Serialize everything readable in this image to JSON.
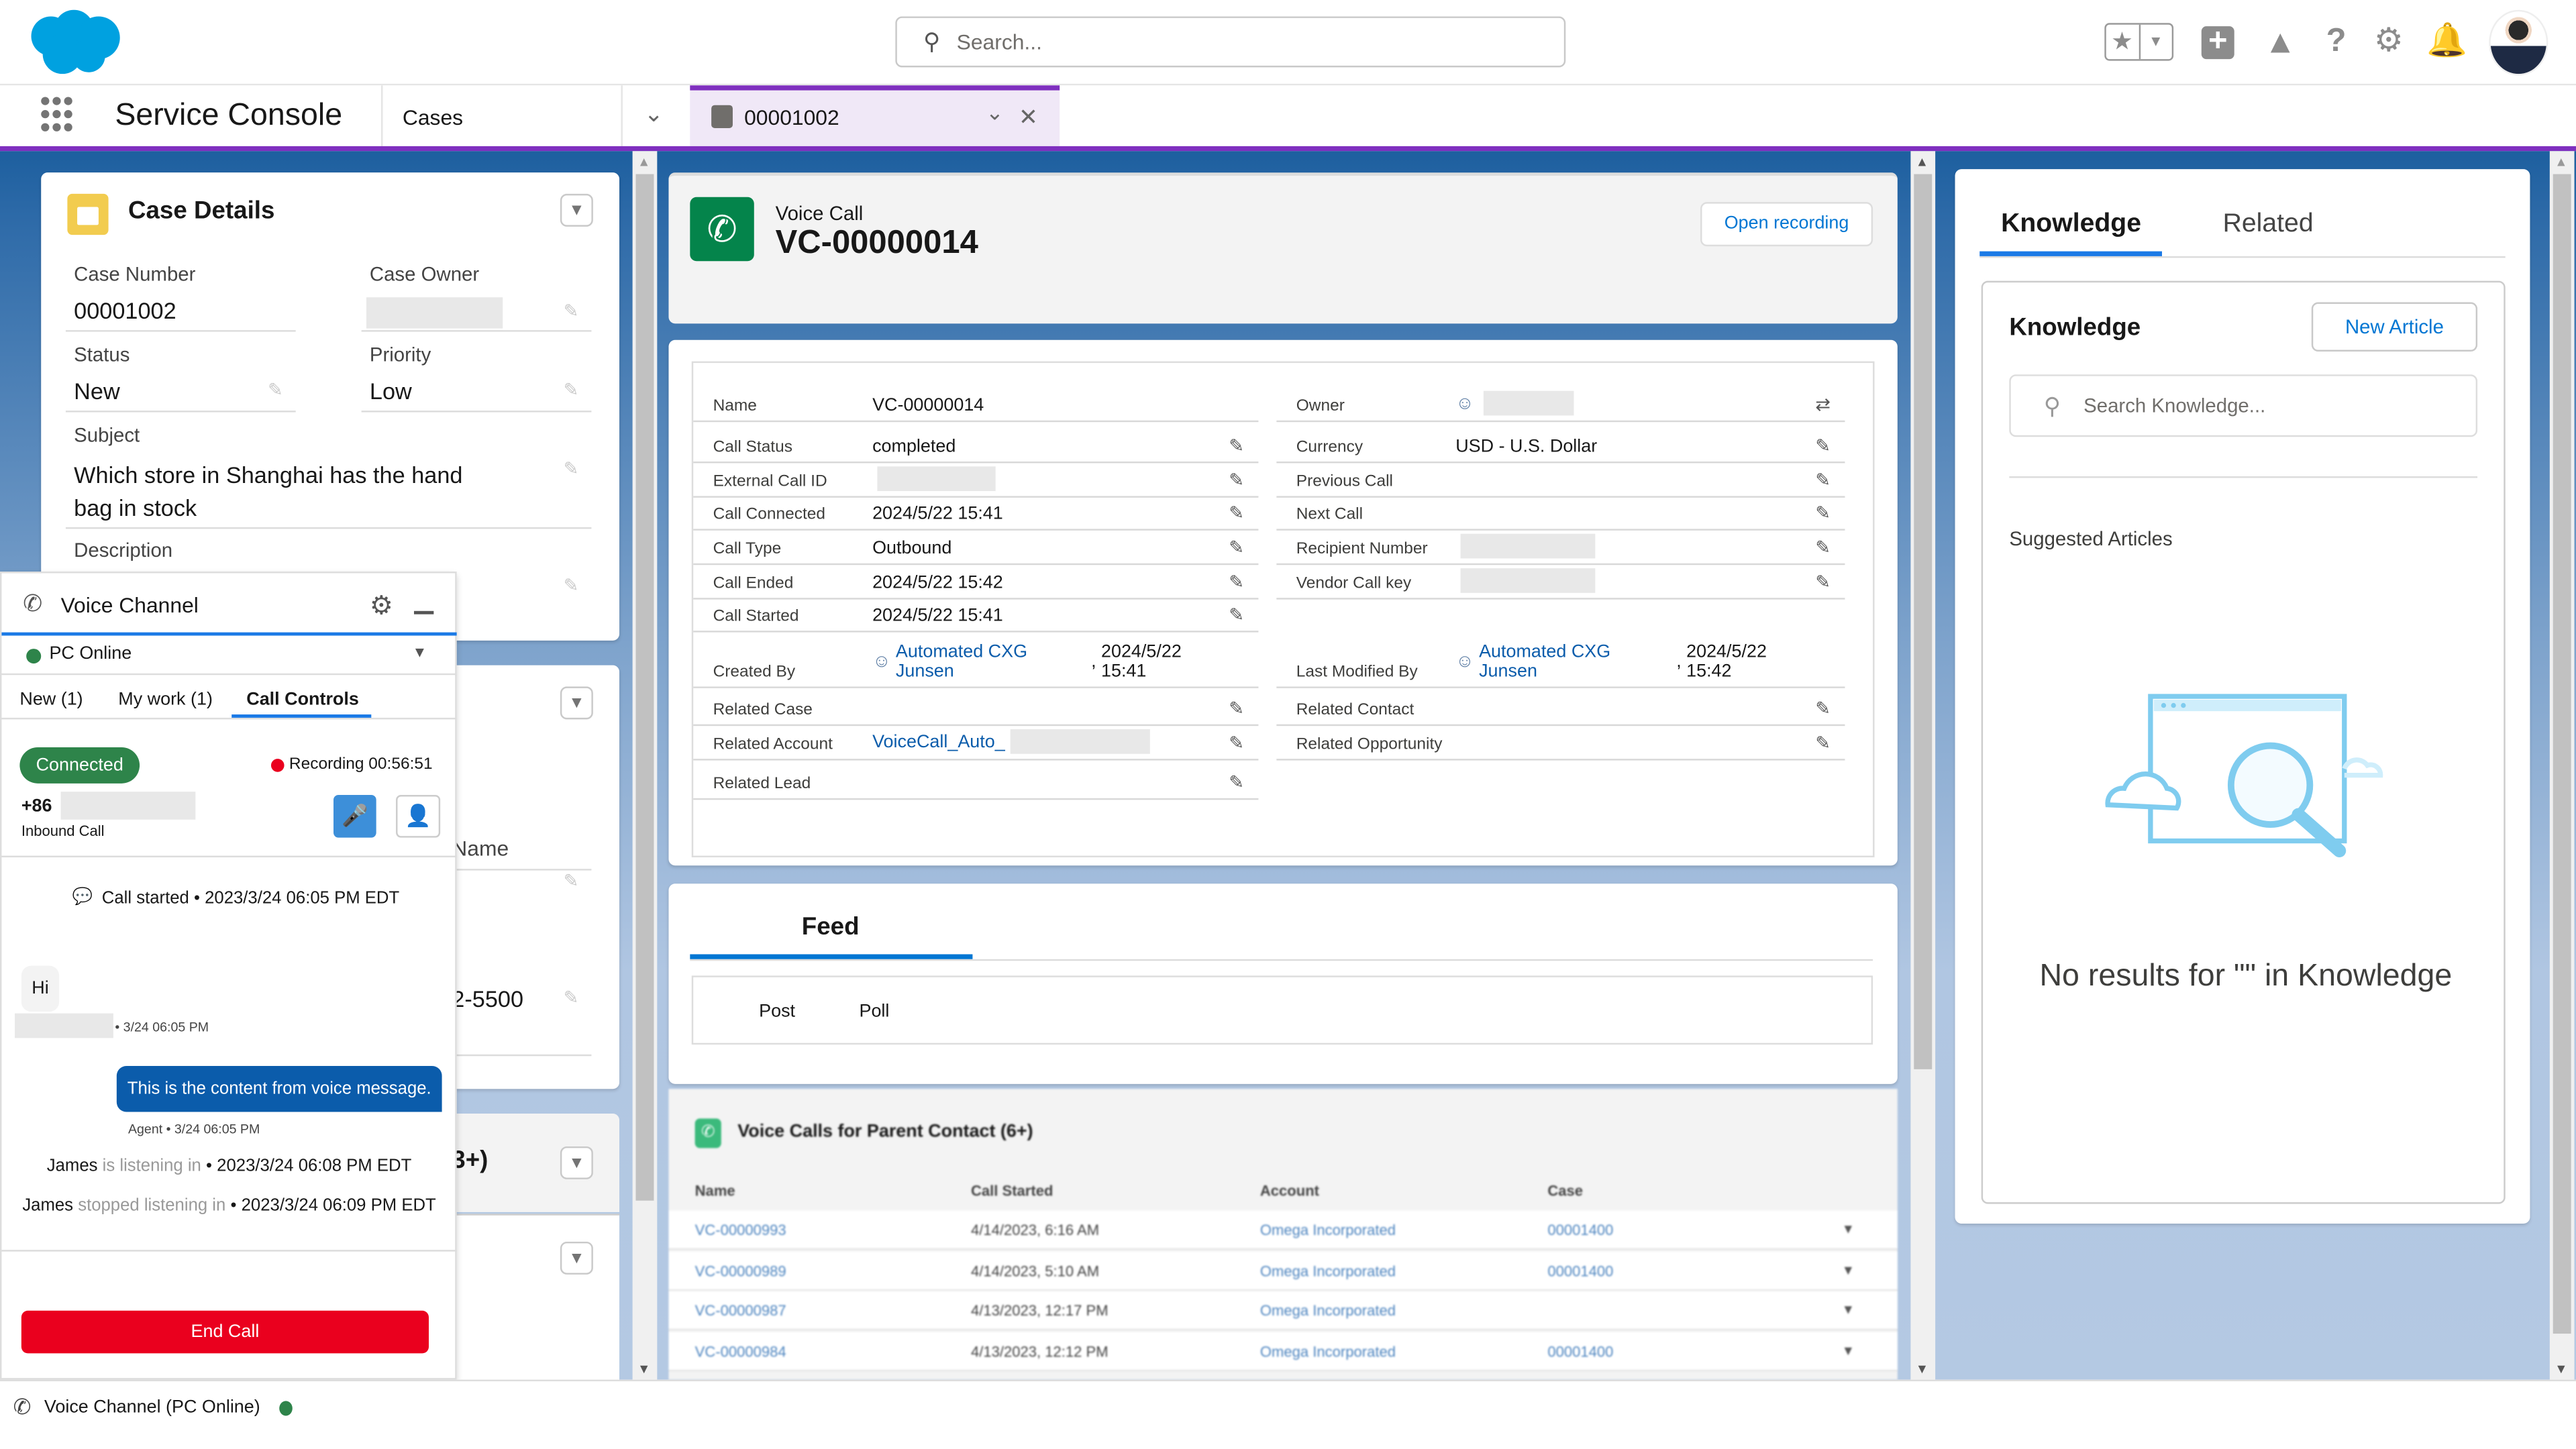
{
  "header": {
    "search_placeholder": "Search...",
    "icons": [
      "favorites-star-icon",
      "favorites-dropdown-icon",
      "global-create-plus-icon",
      "trailhead-icon",
      "help-icon",
      "setup-gear-icon",
      "notifications-bell-icon",
      "user-avatar"
    ]
  },
  "nav": {
    "app_name": "Service Console",
    "object_tab": "Cases",
    "workspace_tab": {
      "label": "00001002",
      "icon": "case-briefcase-icon"
    }
  },
  "colors": {
    "brand": "#00a1e0",
    "accent_purple": "#7f2fbf",
    "voice_green": "#04844b",
    "connected_green": "#2e844a",
    "end_call_red": "#ea001e",
    "message_blue": "#0b5cab",
    "link": "#0b5cab"
  },
  "case_details": {
    "title": "Case Details",
    "fields": {
      "case_number_label": "Case Number",
      "case_number": "00001002",
      "case_owner_label": "Case Owner",
      "status_label": "Status",
      "status": "New",
      "priority_label": "Priority",
      "priority": "Low",
      "subject_label": "Subject",
      "subject": "Which store in Shanghai has the hand bag in stock",
      "description_label": "Description"
    },
    "partial_texts": {
      "name": "Name",
      "phone": "2-5500",
      "count": "3+)"
    }
  },
  "voice_call": {
    "object_label": "Voice Call",
    "name": "VC-00000014",
    "open_recording": "Open recording",
    "left_fields": [
      {
        "label": "Name",
        "value": "VC-00000014"
      },
      {
        "label": "Call Status",
        "value": "completed"
      },
      {
        "label": "External Call ID",
        "value": ""
      },
      {
        "label": "Call Connected",
        "value": "2024/5/22 15:41"
      },
      {
        "label": "Call Type",
        "value": "Outbound"
      },
      {
        "label": "Call Ended",
        "value": "2024/5/22 15:42"
      },
      {
        "label": "Call Started",
        "value": "2024/5/22 15:41"
      }
    ],
    "right_fields": [
      {
        "label": "Owner",
        "value": ""
      },
      {
        "label": "Currency",
        "value": "USD - U.S. Dollar"
      },
      {
        "label": "Previous Call",
        "value": ""
      },
      {
        "label": "Next Call",
        "value": ""
      },
      {
        "label": "Recipient Number",
        "value": ""
      },
      {
        "label": "Vendor Call key",
        "value": ""
      }
    ],
    "created_by": {
      "label": "Created By",
      "user": "Automated CXG Junsen",
      "date": "2024/5/22 15:41"
    },
    "last_modified_by": {
      "label": "Last Modified By",
      "user": "Automated CXG Junsen",
      "date": "2024/5/22 15:42"
    },
    "related_left": [
      {
        "label": "Related Case",
        "value": ""
      },
      {
        "label": "Related Account",
        "value": "VoiceCall_Auto_"
      },
      {
        "label": "Related Lead",
        "value": ""
      }
    ],
    "related_right": [
      {
        "label": "Related Contact",
        "value": ""
      },
      {
        "label": "Related Opportunity",
        "value": ""
      }
    ]
  },
  "feed": {
    "title": "Feed",
    "actions": [
      "Post",
      "Poll"
    ]
  },
  "related_list": {
    "title": "Voice Calls for Parent Contact (6+)",
    "columns": [
      "Name",
      "Call Started",
      "Account",
      "Case"
    ],
    "rows": [
      {
        "name": "VC-00000993",
        "started": "4/14/2023, 6:16 AM",
        "account": "Omega Incorporated",
        "case": "00001400"
      },
      {
        "name": "VC-00000989",
        "started": "4/14/2023, 5:10 AM",
        "account": "Omega Incorporated",
        "case": "00001400"
      },
      {
        "name": "VC-00000987",
        "started": "4/13/2023, 12:17 PM",
        "account": "Omega Incorporated",
        "case": ""
      },
      {
        "name": "VC-00000984",
        "started": "4/13/2023, 12:12 PM",
        "account": "Omega Incorporated",
        "case": "00001400"
      }
    ]
  },
  "knowledge": {
    "tabs": [
      "Knowledge",
      "Related"
    ],
    "active_tab": "Knowledge",
    "title": "Knowledge",
    "new_article": "New Article",
    "search_placeholder": "Search Knowledge...",
    "suggested": "Suggested Articles",
    "no_results": "No results for \"\" in Knowledge"
  },
  "voice_channel": {
    "title": "Voice Channel",
    "presence": "PC Online",
    "tabs": [
      "New (1)",
      "My work (1)",
      "Call Controls"
    ],
    "active_tab": "Call Controls",
    "status": "Connected",
    "recording": "Recording 00:56:51",
    "phone_prefix": "+86",
    "call_type": "Inbound Call",
    "call_started": "Call started • 2023/3/24 06:05 PM EDT",
    "messages": [
      {
        "text": "Hi",
        "meta": "• 3/24 06:05 PM"
      },
      {
        "text": "This is the content from voice message.",
        "meta": "Agent • 3/24 06:05 PM"
      }
    ],
    "events": [
      {
        "who": "James",
        "action": "is listening in",
        "when": "• 2023/3/24 06:08 PM EDT"
      },
      {
        "who": "James",
        "action": "stopped listening in",
        "when": "• 2023/3/24 06:09 PM EDT"
      }
    ],
    "end_call": "End Call"
  },
  "footer": {
    "utility": "Voice Channel (PC Online)"
  }
}
